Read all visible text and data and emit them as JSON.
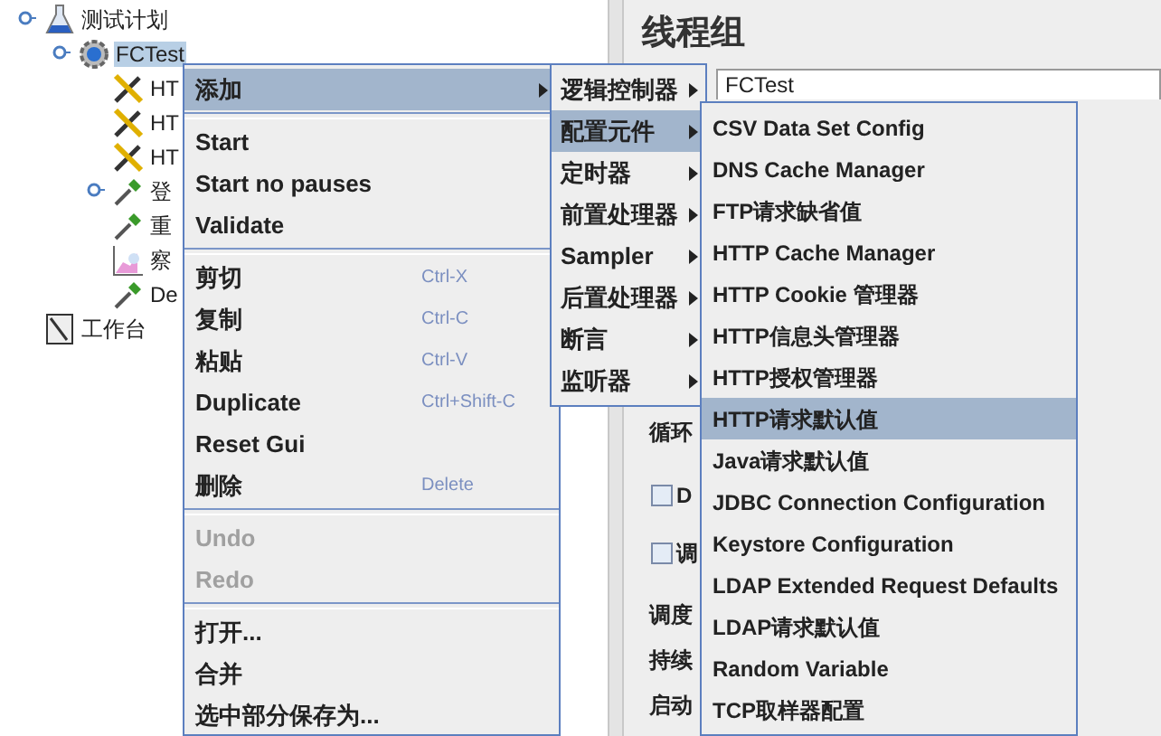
{
  "tree": [
    {
      "label": "测试计划",
      "kind": "plan",
      "selected": false,
      "children": [
        {
          "label": "FCTest",
          "kind": "thread_group",
          "selected": true,
          "children": [
            {
              "label": "HT",
              "kind": "config",
              "selected": false
            },
            {
              "label": "HT",
              "kind": "config",
              "selected": false
            },
            {
              "label": "HT",
              "kind": "config",
              "selected": false
            },
            {
              "label": "登",
              "kind": "sampler",
              "selected": false,
              "children_hidden": true
            },
            {
              "label": "重",
              "kind": "sampler",
              "selected": false
            },
            {
              "label": "察",
              "kind": "listener",
              "selected": false
            },
            {
              "label": "De",
              "kind": "sampler",
              "selected": false
            }
          ]
        }
      ]
    },
    {
      "label": "工作台",
      "kind": "workbench",
      "selected": false
    }
  ],
  "panel": {
    "title": "线程组",
    "name_value": "FCTest",
    "labels": [
      "循环",
      "调度",
      "持续",
      "启动"
    ],
    "checkboxes": [
      {
        "label": "D",
        "checked": false
      },
      {
        "label": "调",
        "checked": false
      }
    ]
  },
  "context_menu": {
    "groups": [
      [
        {
          "label": "添加",
          "submenu": true,
          "selected": true,
          "disabled": false
        }
      ],
      [
        {
          "label": "Start",
          "selected": false,
          "disabled": false
        },
        {
          "label": "Start no pauses",
          "selected": false,
          "disabled": false
        },
        {
          "label": "Validate",
          "selected": false,
          "disabled": false
        }
      ],
      [
        {
          "label": "剪切",
          "shortcut": "Ctrl-X",
          "selected": false,
          "disabled": false
        },
        {
          "label": "复制",
          "shortcut": "Ctrl-C",
          "selected": false,
          "disabled": false
        },
        {
          "label": "粘贴",
          "shortcut": "Ctrl-V",
          "selected": false,
          "disabled": false
        },
        {
          "label": "Duplicate",
          "shortcut": "Ctrl+Shift-C",
          "selected": false,
          "disabled": false
        },
        {
          "label": "Reset Gui",
          "selected": false,
          "disabled": false
        },
        {
          "label": "删除",
          "shortcut": "Delete",
          "selected": false,
          "disabled": false
        }
      ],
      [
        {
          "label": "Undo",
          "selected": false,
          "disabled": true
        },
        {
          "label": "Redo",
          "selected": false,
          "disabled": true
        }
      ],
      [
        {
          "label": "打开...",
          "selected": false,
          "disabled": false
        },
        {
          "label": "合并",
          "selected": false,
          "disabled": false
        },
        {
          "label": "选中部分保存为...",
          "selected": false,
          "disabled": false
        }
      ]
    ]
  },
  "add_menu": [
    {
      "label": "逻辑控制器",
      "selected": false
    },
    {
      "label": "配置元件",
      "selected": true
    },
    {
      "label": "定时器",
      "selected": false
    },
    {
      "label": "前置处理器",
      "selected": false
    },
    {
      "label": "Sampler",
      "selected": false
    },
    {
      "label": "后置处理器",
      "selected": false
    },
    {
      "label": "断言",
      "selected": false
    },
    {
      "label": "监听器",
      "selected": false
    }
  ],
  "config_menu": [
    {
      "label": "CSV Data Set Config",
      "selected": false
    },
    {
      "label": "DNS Cache Manager",
      "selected": false
    },
    {
      "label": "FTP请求缺省值",
      "selected": false
    },
    {
      "label": "HTTP Cache Manager",
      "selected": false
    },
    {
      "label": "HTTP Cookie 管理器",
      "selected": false
    },
    {
      "label": "HTTP信息头管理器",
      "selected": false
    },
    {
      "label": "HTTP授权管理器",
      "selected": false
    },
    {
      "label": "HTTP请求默认值",
      "selected": true
    },
    {
      "label": "Java请求默认值",
      "selected": false
    },
    {
      "label": "JDBC Connection Configuration",
      "selected": false
    },
    {
      "label": "Keystore Configuration",
      "selected": false
    },
    {
      "label": "LDAP Extended Request Defaults",
      "selected": false
    },
    {
      "label": "LDAP请求默认值",
      "selected": false
    },
    {
      "label": "Random Variable",
      "selected": false
    },
    {
      "label": "TCP取样器配置",
      "selected": false
    }
  ]
}
